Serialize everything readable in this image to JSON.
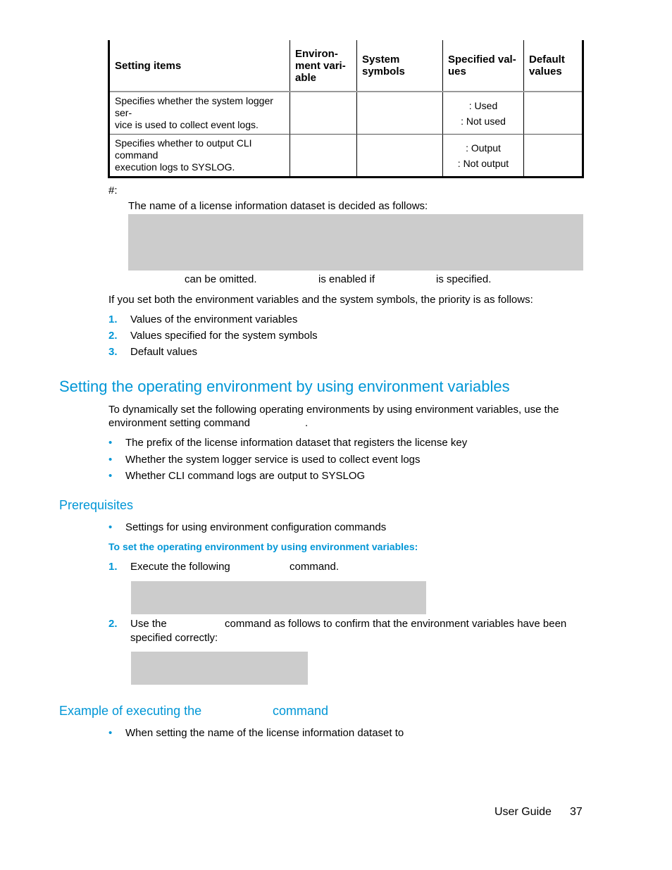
{
  "table": {
    "headers": [
      "Setting items",
      "Environ-ment vari-able",
      "System symbols",
      "Specified val-ues",
      "Default values"
    ],
    "rows": [
      {
        "setting_item": "Specifies whether the system logger ser-vice is used to collect event logs.",
        "environment_variable": "",
        "system_symbols": "",
        "specified_values": [
          ": Used",
          ": Not used"
        ],
        "default_values": ""
      },
      {
        "setting_item": "Specifies whether to output CLI command execution logs to SYSLOG.",
        "environment_variable": "",
        "system_symbols": "",
        "specified_values": [
          ": Output",
          ": Not output"
        ],
        "default_values": ""
      }
    ]
  },
  "note": {
    "marker": "#:",
    "intro": "The name of a license information dataset is decided as follows:",
    "after_code": [
      "can be omitted.",
      "is enabled if",
      "is specified."
    ]
  },
  "priority": {
    "intro": "If you set both the environment variables and the system symbols, the priority is as follows:",
    "items": [
      {
        "num": "1.",
        "text": "Values of the environment variables"
      },
      {
        "num": "2.",
        "text": "Values specified for the system symbols"
      },
      {
        "num": "3.",
        "text": "Default values"
      }
    ]
  },
  "section": {
    "title": "Setting the operating environment by using environment variables",
    "intro_line1": "To dynamically set the following operating environments by using environment variables, use the",
    "intro_line2": "environment setting command",
    "intro_end": ".",
    "bullets": [
      "The prefix of the license information dataset that registers the license key",
      "Whether the system logger service is used to collect event logs",
      "Whether CLI command logs are output to SYSLOG"
    ]
  },
  "prerequisites": {
    "title": "Prerequisites",
    "bullets": [
      "Settings for using environment configuration commands"
    ]
  },
  "procedure": {
    "title": "To set the operating environment by using environment variables:",
    "steps": [
      {
        "num": "1.",
        "text_before": "Execute the following",
        "text_after": "command."
      },
      {
        "num": "2.",
        "text_before": "Use the",
        "text_after": "command as follows to confirm that the environment variables have been",
        "line2": "specified correctly:"
      }
    ]
  },
  "example": {
    "title_before": "Example of executing the",
    "title_after": "command",
    "bullets": [
      "When setting the name of the license information dataset to"
    ]
  },
  "footer": {
    "label": "User Guide",
    "page_number": "37"
  },
  "colors": {
    "accent": "#0096d6",
    "code_box": "#cccccc"
  }
}
